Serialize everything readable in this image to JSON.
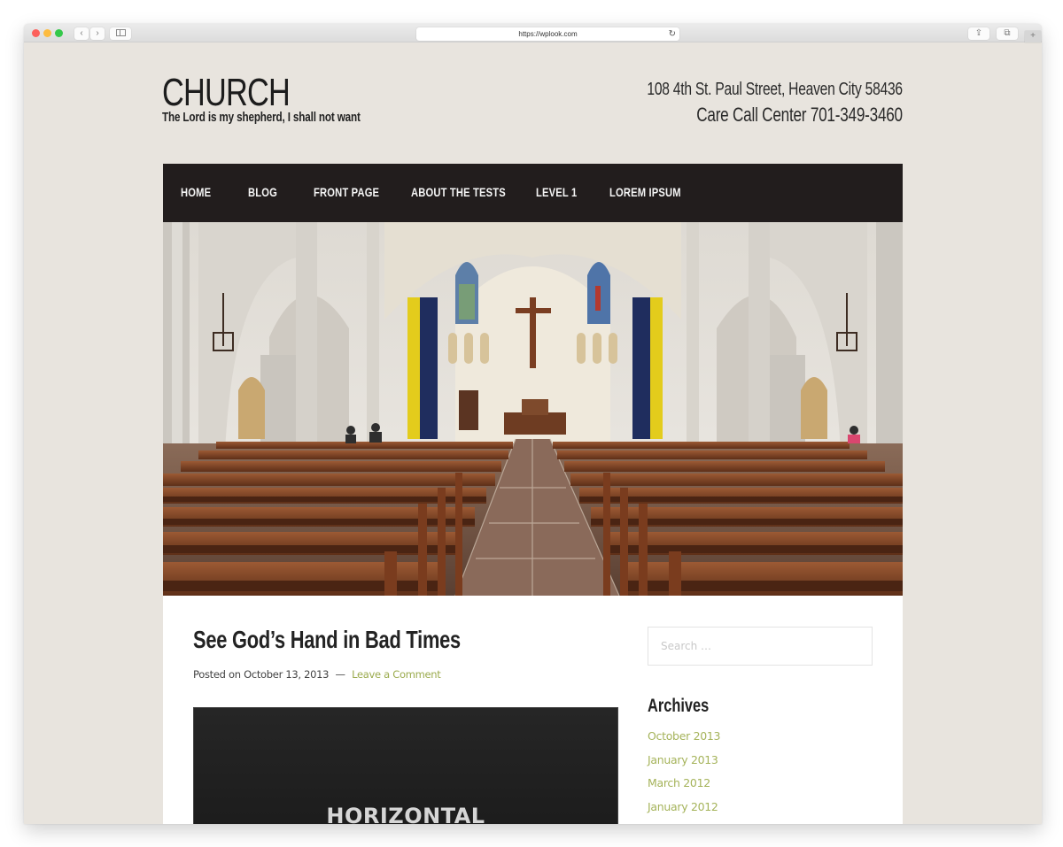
{
  "browser": {
    "url": "https://wplook.com",
    "back_glyph": "‹",
    "forward_glyph": "›",
    "reload_glyph": "↻",
    "share_glyph": "⇪",
    "tabs_glyph": "⧉",
    "newtab_glyph": "+"
  },
  "header": {
    "site_title": "CHURCH",
    "tagline": "The Lord is my shepherd, I shall not want",
    "address": "108 4th St. Paul Street, Heaven City 58436",
    "phone": "Care Call Center 701-349-3460"
  },
  "nav": {
    "items": [
      {
        "label": "Home"
      },
      {
        "label": "Blog"
      },
      {
        "label": "Front Page"
      },
      {
        "label": "About The Tests"
      },
      {
        "label": "Level 1"
      },
      {
        "label": "Lorem Ipsum"
      }
    ]
  },
  "hero": {
    "alt": "Church interior with wooden pews, central aisle and crucifix above the altar"
  },
  "post": {
    "title": "See God’s Hand in Bad Times",
    "posted_prefix": "Posted on",
    "date": "October 13, 2013",
    "separator": "—",
    "comment_link": "Leave a Comment",
    "featured_image_text": "HORIZONTAL"
  },
  "sidebar": {
    "search_placeholder": "Search …",
    "archives_title": "Archives",
    "archives": [
      {
        "label": "October 2013"
      },
      {
        "label": "January 2013"
      },
      {
        "label": "March 2012"
      },
      {
        "label": "January 2012"
      }
    ]
  },
  "colors": {
    "page_background": "#e8e4de",
    "nav_background": "#221d1d",
    "link_accent": "#a5b35a",
    "text_dark": "#232323"
  }
}
